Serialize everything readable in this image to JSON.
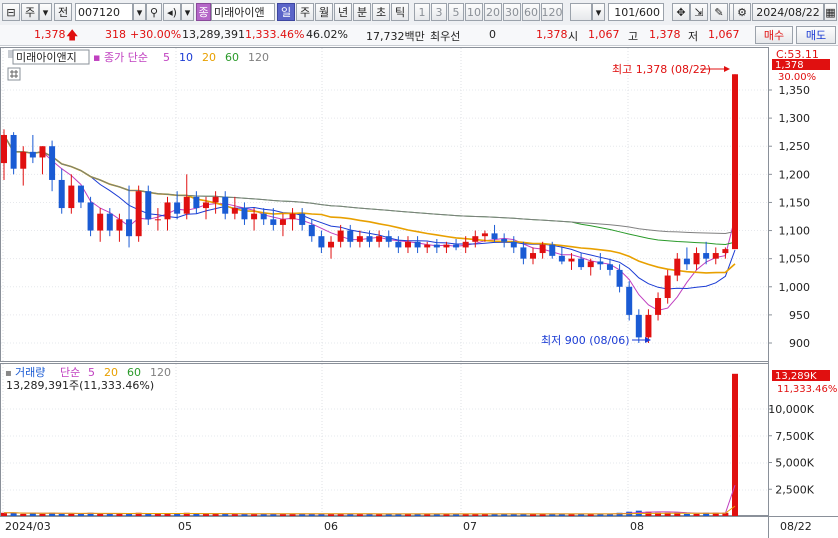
{
  "toolbar": {
    "market": "주",
    "prefix": "전",
    "code": "007120",
    "stock_badge": "종",
    "stock_name": "미래아이앤",
    "periods": [
      "일",
      "주",
      "월",
      "년",
      "분",
      "초",
      "틱"
    ],
    "active_period": "일",
    "numbers": [
      "1",
      "3",
      "5",
      "10",
      "20",
      "30",
      "60",
      "120"
    ],
    "count": "101",
    "total": "/600",
    "date": "2024/08/22"
  },
  "quote": {
    "price": "1,378",
    "change": "318",
    "change_pct": "+30.00%",
    "volume": "13,289,391",
    "volume_pct": "1,333.46%",
    "turnover": "46.02%",
    "amount": "17,732백만",
    "priority_label": "최우선",
    "priority_value": "0",
    "last": "1,378",
    "open_label": "시",
    "open": "1,067",
    "high_label": "고",
    "high": "1,378",
    "low_label": "저",
    "low": "1,067",
    "buy_button": "매수",
    "sell_button": "매도"
  },
  "price_panel": {
    "name": "미래아이앤지",
    "legend_label": "종가 단순",
    "ma_labels": [
      "5",
      "10",
      "20",
      "60",
      "120"
    ],
    "ma_colors": [
      "#c040c0",
      "#1a3bd4",
      "#e8a000",
      "#2a9a2a",
      "#808080"
    ],
    "max_annotation": "최고 1,378 (08/22)",
    "min_annotation": "최저 900 (08/06)",
    "current_label": "1,378",
    "pct_label": "30.00%",
    "c_label": "C:53.11",
    "y_ticks": [
      "1,350",
      "1,300",
      "1,250",
      "1,200",
      "1,150",
      "1,100",
      "1,050",
      "1,000",
      "950",
      "900"
    ]
  },
  "volume_panel": {
    "label": "거래량",
    "legend_label": "단순",
    "ma_labels": [
      "5",
      "20",
      "60",
      "120"
    ],
    "ma_colors": [
      "#c040c0",
      "#e8a000",
      "#2a9a2a",
      "#808080"
    ],
    "info": "13,289,391주(11,333.46%)",
    "current_label": "13,289K",
    "pct_label": "11,333.46%",
    "y_ticks": [
      "10,000K",
      "7,500K",
      "5,000K",
      "2,500K"
    ]
  },
  "x_axis": {
    "labels": [
      "2024/03",
      "05",
      "06",
      "07",
      "08"
    ],
    "end_label": "08/22"
  },
  "colors": {
    "up": "#e01010",
    "down": "#1a5bd4",
    "active_tab": "#5a64c8",
    "stock_badge": "#b567c8"
  },
  "chart_data": {
    "type": "candlestick",
    "summary": {
      "high": 1378,
      "high_date": "08/22",
      "low": 900,
      "low_date": "08/06",
      "last": 1378,
      "change_pct": 30.0,
      "last_volume": 13289391
    },
    "y_range": [
      880,
      1400
    ],
    "volume_range": [
      0,
      13300000
    ],
    "candles": [
      [
        1220,
        1280,
        1190,
        1270,
        1
      ],
      [
        1270,
        1275,
        1200,
        1210,
        -1
      ],
      [
        1210,
        1250,
        1180,
        1240,
        1
      ],
      [
        1240,
        1270,
        1220,
        1230,
        -1
      ],
      [
        1230,
        1250,
        1200,
        1250,
        1
      ],
      [
        1250,
        1260,
        1170,
        1190,
        -1
      ],
      [
        1190,
        1210,
        1130,
        1140,
        -1
      ],
      [
        1140,
        1200,
        1130,
        1180,
        1
      ],
      [
        1180,
        1180,
        1140,
        1150,
        -1
      ],
      [
        1150,
        1160,
        1090,
        1100,
        -1
      ],
      [
        1100,
        1140,
        1080,
        1130,
        1
      ],
      [
        1130,
        1140,
        1090,
        1100,
        -1
      ],
      [
        1100,
        1130,
        1080,
        1120,
        1
      ],
      [
        1120,
        1180,
        1070,
        1090,
        -1
      ],
      [
        1090,
        1180,
        1080,
        1170,
        1
      ],
      [
        1170,
        1180,
        1110,
        1120,
        -1
      ],
      [
        1120,
        1140,
        1100,
        1120,
        1
      ],
      [
        1120,
        1160,
        1100,
        1150,
        1
      ],
      [
        1150,
        1170,
        1120,
        1130,
        -1
      ],
      [
        1130,
        1200,
        1120,
        1160,
        1
      ],
      [
        1160,
        1170,
        1130,
        1140,
        -1
      ],
      [
        1140,
        1160,
        1120,
        1150,
        1
      ],
      [
        1150,
        1170,
        1130,
        1160,
        1
      ],
      [
        1160,
        1170,
        1120,
        1130,
        -1
      ],
      [
        1130,
        1160,
        1120,
        1140,
        1
      ],
      [
        1140,
        1150,
        1110,
        1120,
        -1
      ],
      [
        1120,
        1140,
        1100,
        1130,
        1
      ],
      [
        1130,
        1140,
        1110,
        1120,
        -1
      ],
      [
        1120,
        1140,
        1100,
        1110,
        -1
      ],
      [
        1110,
        1130,
        1090,
        1120,
        1
      ],
      [
        1120,
        1140,
        1100,
        1130,
        1
      ],
      [
        1130,
        1140,
        1100,
        1110,
        -1
      ],
      [
        1110,
        1120,
        1080,
        1090,
        -1
      ],
      [
        1090,
        1100,
        1060,
        1070,
        -1
      ],
      [
        1070,
        1090,
        1050,
        1080,
        1
      ],
      [
        1080,
        1110,
        1070,
        1100,
        1
      ],
      [
        1100,
        1110,
        1070,
        1080,
        -1
      ],
      [
        1080,
        1100,
        1070,
        1090,
        1
      ],
      [
        1090,
        1100,
        1070,
        1080,
        -1
      ],
      [
        1080,
        1100,
        1070,
        1090,
        1
      ],
      [
        1090,
        1100,
        1070,
        1080,
        -1
      ],
      [
        1080,
        1090,
        1060,
        1070,
        -1
      ],
      [
        1070,
        1090,
        1060,
        1080,
        1
      ],
      [
        1080,
        1090,
        1060,
        1070,
        -1
      ],
      [
        1070,
        1080,
        1060,
        1075,
        1
      ],
      [
        1075,
        1085,
        1060,
        1070,
        -1
      ],
      [
        1070,
        1080,
        1060,
        1075,
        1
      ],
      [
        1075,
        1085,
        1065,
        1070,
        -1
      ],
      [
        1070,
        1090,
        1060,
        1080,
        1
      ],
      [
        1080,
        1100,
        1070,
        1090,
        1
      ],
      [
        1090,
        1100,
        1080,
        1095,
        1
      ],
      [
        1095,
        1110,
        1080,
        1085,
        -1
      ],
      [
        1085,
        1095,
        1070,
        1080,
        -1
      ],
      [
        1080,
        1090,
        1060,
        1070,
        -1
      ],
      [
        1070,
        1080,
        1040,
        1050,
        -1
      ],
      [
        1050,
        1070,
        1040,
        1060,
        1
      ],
      [
        1060,
        1080,
        1050,
        1075,
        1
      ],
      [
        1075,
        1080,
        1050,
        1055,
        -1
      ],
      [
        1055,
        1070,
        1040,
        1045,
        -1
      ],
      [
        1045,
        1060,
        1030,
        1050,
        1
      ],
      [
        1050,
        1060,
        1030,
        1035,
        -1
      ],
      [
        1035,
        1050,
        1020,
        1045,
        1
      ],
      [
        1045,
        1060,
        1030,
        1040,
        -1
      ],
      [
        1040,
        1050,
        1020,
        1030,
        -1
      ],
      [
        1030,
        1040,
        990,
        1000,
        -1
      ],
      [
        1000,
        1010,
        940,
        950,
        -1
      ],
      [
        950,
        960,
        900,
        910,
        -1
      ],
      [
        910,
        960,
        900,
        950,
        1
      ],
      [
        950,
        990,
        940,
        980,
        1
      ],
      [
        980,
        1030,
        970,
        1020,
        1
      ],
      [
        1020,
        1060,
        1010,
        1050,
        1
      ],
      [
        1050,
        1070,
        1030,
        1040,
        -1
      ],
      [
        1040,
        1070,
        1030,
        1060,
        1
      ],
      [
        1060,
        1080,
        1040,
        1050,
        -1
      ],
      [
        1050,
        1070,
        1040,
        1060,
        1
      ],
      [
        1060,
        1070,
        1050,
        1067,
        1
      ],
      [
        1067,
        1378,
        1067,
        1378,
        1
      ]
    ],
    "volumes": [
      0.3,
      0.3,
      0.2,
      0.3,
      0.2,
      0.3,
      0.2,
      0.2,
      0.2,
      0.3,
      0.2,
      0.2,
      0.2,
      0.2,
      0.3,
      0.2,
      0.2,
      0.2,
      0.2,
      0.3,
      0.2,
      0.2,
      0.2,
      0.2,
      0.2,
      0.2,
      0.2,
      0.2,
      0.2,
      0.2,
      0.2,
      0.2,
      0.2,
      0.2,
      0.2,
      0.2,
      0.2,
      0.2,
      0.2,
      0.2,
      0.2,
      0.2,
      0.2,
      0.2,
      0.2,
      0.2,
      0.2,
      0.2,
      0.2,
      0.2,
      0.2,
      0.2,
      0.2,
      0.2,
      0.2,
      0.2,
      0.2,
      0.2,
      0.2,
      0.2,
      0.2,
      0.2,
      0.2,
      0.2,
      0.3,
      0.4,
      0.5,
      0.4,
      0.3,
      0.3,
      0.3,
      0.2,
      0.2,
      0.3,
      0.3,
      0.3,
      13.29
    ]
  }
}
